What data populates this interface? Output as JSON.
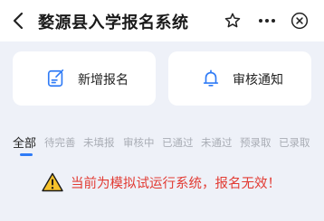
{
  "header": {
    "title": "婺源县入学报名系统",
    "back_icon": "chevron-left-icon",
    "star_icon": "star-icon",
    "more_icon": "more-dots-icon",
    "close_icon": "close-circle-icon"
  },
  "actions": [
    {
      "label": "新增报名",
      "icon": "edit-note-icon",
      "color": "#2f7bf6"
    },
    {
      "label": "审核通知",
      "icon": "bell-icon",
      "color": "#2f7bf6"
    }
  ],
  "tabs": [
    {
      "label": "全部",
      "active": true
    },
    {
      "label": "待完善",
      "active": false
    },
    {
      "label": "未填报",
      "active": false
    },
    {
      "label": "审核中",
      "active": false
    },
    {
      "label": "已通过",
      "active": false
    },
    {
      "label": "未通过",
      "active": false
    },
    {
      "label": "预录取",
      "active": false
    },
    {
      "label": "已录取",
      "active": false
    }
  ],
  "warning": {
    "text": "当前为模拟试运行系统，报名无效！",
    "icon": "warning-triangle-icon",
    "color": "#e23b33"
  }
}
